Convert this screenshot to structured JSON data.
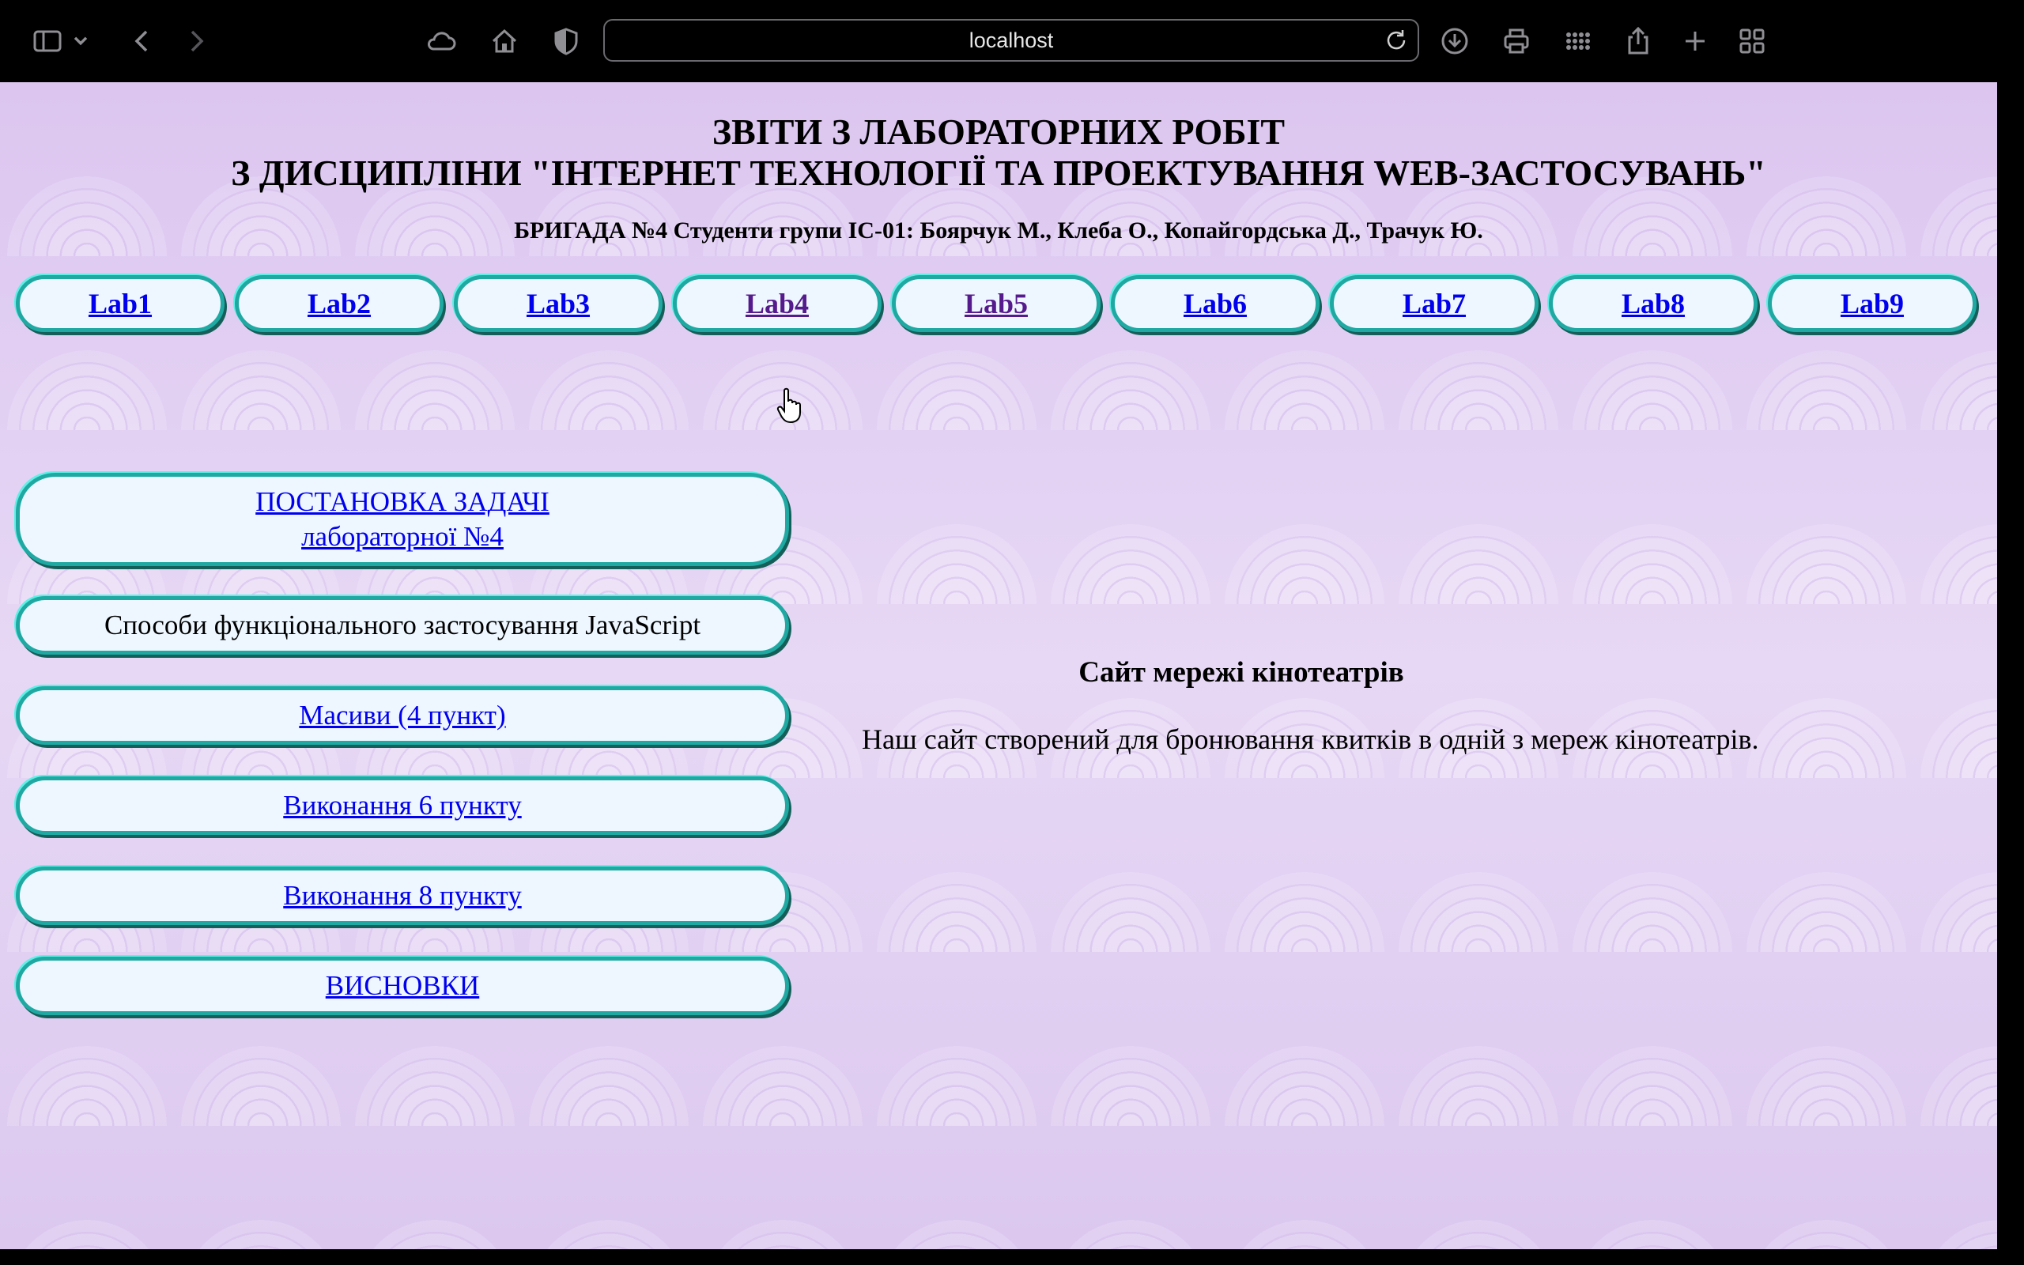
{
  "browser": {
    "address": "localhost"
  },
  "header": {
    "title_line1": "ЗВІТИ З ЛАБОРАТОРНИХ РОБІТ",
    "title_line2": "З ДИСЦИПЛІНИ \"ІНТЕРНЕТ ТЕХНОЛОГІЇ ТА ПРОЕКТУВАННЯ WEB-ЗАСТОСУВАНЬ\"",
    "brigade": "БРИГАДА №4 Студенти групи ІС-01: Боярчук М., Клеба О., Копайгордська Д., Трачук Ю."
  },
  "labs": [
    {
      "label": "Lab1",
      "visited": false
    },
    {
      "label": "Lab2",
      "visited": false
    },
    {
      "label": "Lab3",
      "visited": false
    },
    {
      "label": "Lab4",
      "visited": true
    },
    {
      "label": "Lab5",
      "visited": true
    },
    {
      "label": "Lab6",
      "visited": false
    },
    {
      "label": "Lab7",
      "visited": false
    },
    {
      "label": "Lab8",
      "visited": false
    },
    {
      "label": "Lab9",
      "visited": false
    }
  ],
  "sidebar": {
    "task_line1": "ПОСТАНОВКА ЗАДАЧІ",
    "task_line2": "лабораторної №4",
    "functional": "Способи функціонального застосування JavaScript",
    "arrays": "Масиви (4 пункт)",
    "point6": "Виконання 6 пункту",
    "point8": "Виконання 8 пункту",
    "conclusions": "ВИСНОВКИ"
  },
  "content": {
    "title": "Сайт мережі кінотеатрів",
    "text": "Наш сайт створений для бронювання квитків в одній з мереж кінотеатрів."
  }
}
